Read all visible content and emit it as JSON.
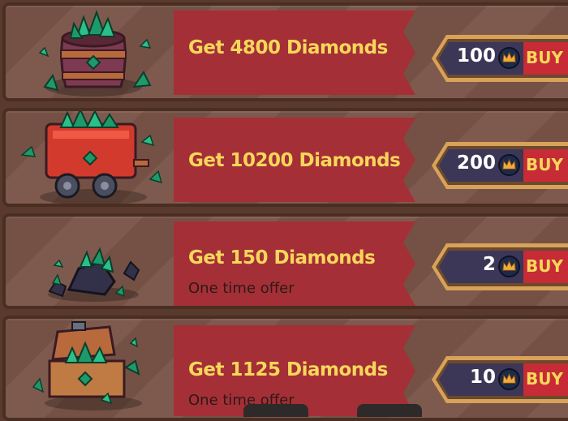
{
  "offers": [
    {
      "title": "Get 4800 Diamonds",
      "subtitle": "",
      "price": "100",
      "buy_label": "BUY",
      "illustration": "diamond-barrel-icon"
    },
    {
      "title": "Get 10200 Diamonds",
      "subtitle": "",
      "price": "200",
      "buy_label": "BUY",
      "illustration": "diamond-minecart-icon"
    },
    {
      "title": "Get 150 Diamonds",
      "subtitle": "One time offer",
      "price": "2",
      "buy_label": "BUY",
      "illustration": "diamond-rocks-icon"
    },
    {
      "title": "Get 1125 Diamonds",
      "subtitle": "One time offer",
      "price": "10",
      "buy_label": "BUY",
      "illustration": "diamond-chest-icon"
    }
  ],
  "currency_icon": "crown-coin-icon",
  "colors": {
    "banner": "#a52f37",
    "title_text": "#f7d75a",
    "buy_button": "#c62b36",
    "price_panel": "#3c3657",
    "gem": "#1e9a6a"
  }
}
